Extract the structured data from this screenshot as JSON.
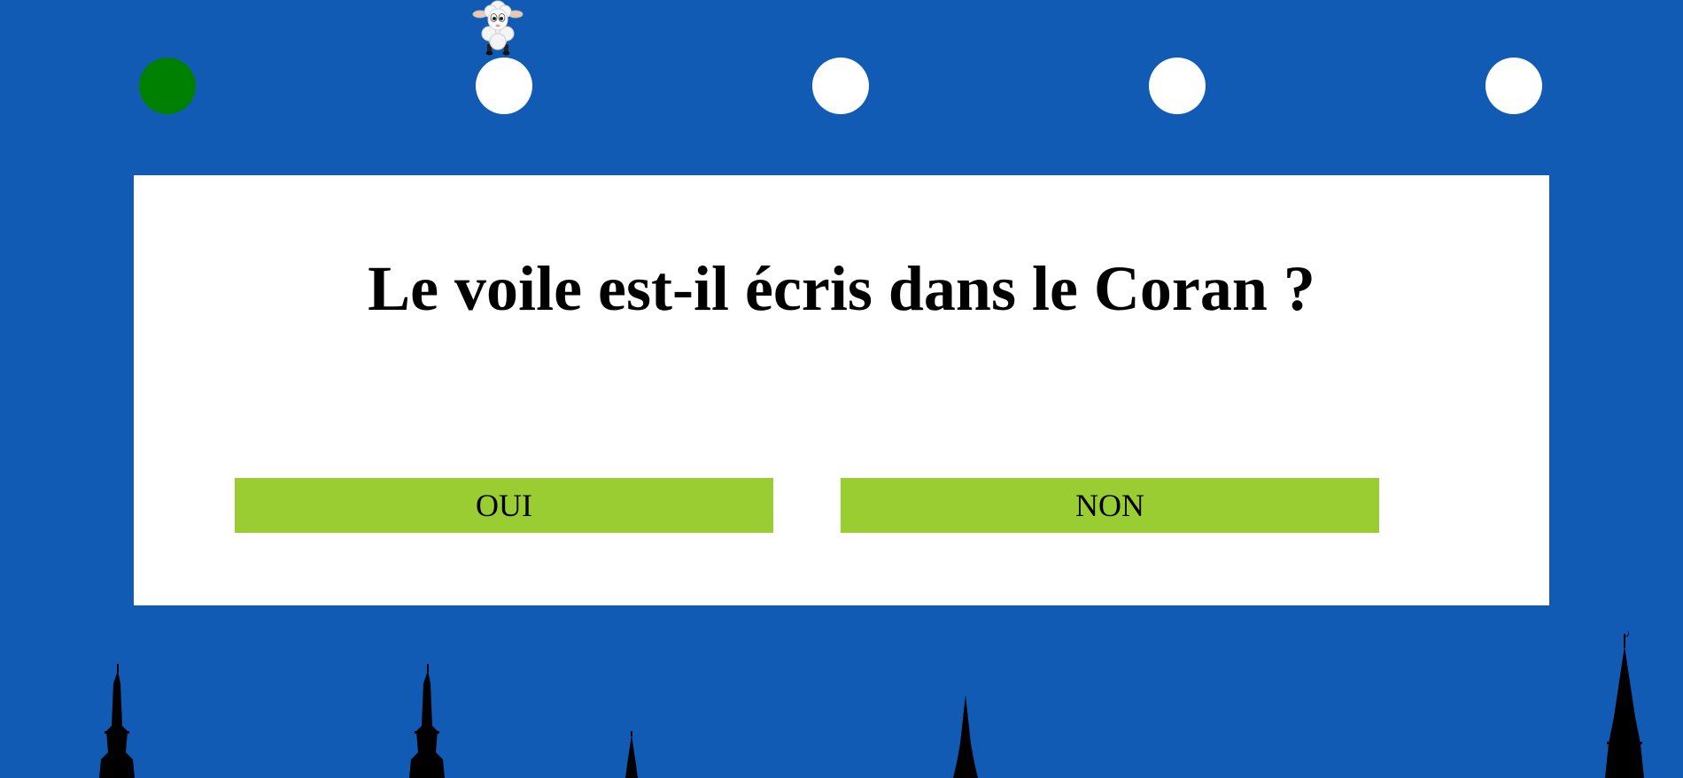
{
  "progress": {
    "total_steps": 5,
    "completed_steps": 1,
    "current_step": 2,
    "colors": {
      "completed": "#008000",
      "pending": "#ffffff"
    }
  },
  "question": {
    "text": "Le voile est-il écris dans le Coran ?"
  },
  "answers": {
    "yes_label": "OUI",
    "no_label": "NON",
    "button_color": "#9acd32"
  },
  "theme": {
    "background": "#125bb4",
    "card": "#ffffff",
    "silhouette": "#000000"
  },
  "icons": {
    "player": "sheep-icon",
    "decor": "minaret-silhouette"
  }
}
